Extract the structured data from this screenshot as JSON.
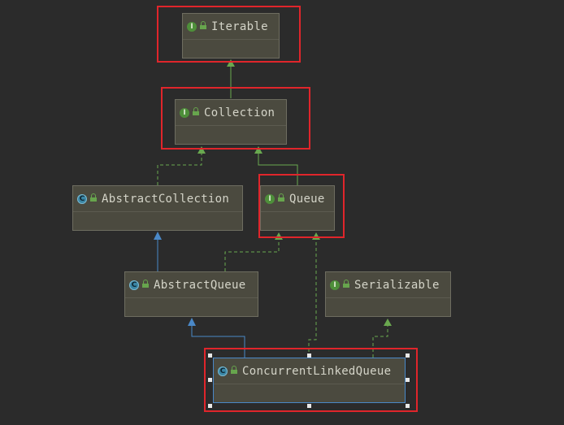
{
  "nodes": {
    "iterable": {
      "label": "Iterable",
      "kind": "interface"
    },
    "collection": {
      "label": "Collection",
      "kind": "interface"
    },
    "abstract_collection": {
      "label": "AbstractCollection",
      "kind": "abstract-class"
    },
    "queue": {
      "label": "Queue",
      "kind": "interface"
    },
    "abstract_queue": {
      "label": "AbstractQueue",
      "kind": "abstract-class"
    },
    "serializable": {
      "label": "Serializable",
      "kind": "interface"
    },
    "concurrent_linked_queue": {
      "label": "ConcurrentLinkedQueue",
      "kind": "class"
    }
  },
  "badges": {
    "interface": "I",
    "class": "C"
  },
  "edges": [
    {
      "from": "Collection",
      "to": "Iterable",
      "type": "extends"
    },
    {
      "from": "AbstractCollection",
      "to": "Collection",
      "type": "implements"
    },
    {
      "from": "Queue",
      "to": "Collection",
      "type": "extends"
    },
    {
      "from": "AbstractQueue",
      "to": "AbstractCollection",
      "type": "extends-class"
    },
    {
      "from": "AbstractQueue",
      "to": "Queue",
      "type": "implements"
    },
    {
      "from": "ConcurrentLinkedQueue",
      "to": "AbstractQueue",
      "type": "extends-class"
    },
    {
      "from": "ConcurrentLinkedQueue",
      "to": "Queue",
      "type": "implements"
    },
    {
      "from": "ConcurrentLinkedQueue",
      "to": "Serializable",
      "type": "implements"
    }
  ],
  "highlighted": [
    "Iterable",
    "Collection",
    "Queue",
    "ConcurrentLinkedQueue"
  ],
  "selected": "ConcurrentLinkedQueue",
  "colors": {
    "background": "#2b2b2b",
    "node_fill": "#4b4a3f",
    "interface_edge": "#6aa84f",
    "class_edge": "#4a88c7",
    "highlight": "#e0252b"
  }
}
